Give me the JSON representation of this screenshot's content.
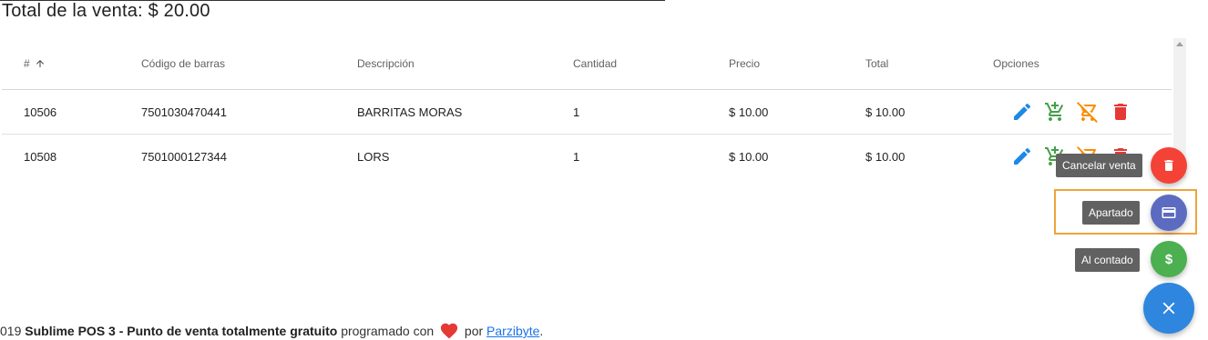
{
  "header": {
    "total_label": "Total de la venta: $ 20.00"
  },
  "table": {
    "columns": [
      "#",
      "Código de barras",
      "Descripción",
      "Cantidad",
      "Precio",
      "Total",
      "Opciones"
    ],
    "sort_indicator": "arrow-up-icon",
    "rows": [
      {
        "id": "10506",
        "barcode": "7501030470441",
        "description": "BARRITAS MORAS",
        "quantity": "1",
        "price": "$ 10.00",
        "total": "$ 10.00"
      },
      {
        "id": "10508",
        "barcode": "7501000127344",
        "description": "LORS",
        "quantity": "1",
        "price": "$ 10.00",
        "total": "$ 10.00"
      }
    ],
    "row_actions": [
      "pencil-icon",
      "cart-plus-icon",
      "cart-remove-icon",
      "trash-icon"
    ]
  },
  "fab_menu": {
    "cancel_label": "Cancelar venta",
    "layaway_label": "Apartado",
    "cash_label": "Al contado",
    "cash_symbol": "$"
  },
  "footer": {
    "year_fragment": "019",
    "product": "Sublime POS 3 - Punto de venta totalmente gratuito",
    "programmed_text": "programado con",
    "by_text": "por",
    "author_link": "Parzibyte",
    "end": "."
  },
  "colors": {
    "edit_blue": "#1e88e5",
    "add_green": "#43a047",
    "remove_orange": "#fb8c00",
    "delete_red": "#e53935",
    "fab_red": "#f44336",
    "fab_indigo": "#5c6bc0",
    "fab_green": "#4caf50",
    "fab_blue": "#2e86de",
    "highlight": "#f0a33c"
  }
}
